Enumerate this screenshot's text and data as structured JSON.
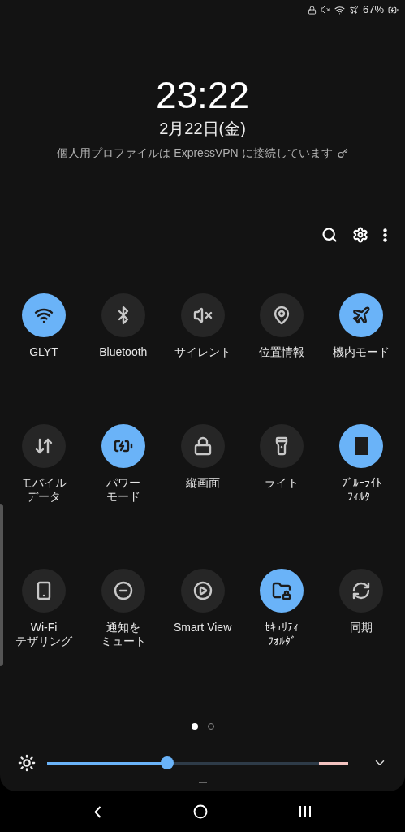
{
  "status_bar": {
    "battery": "67%"
  },
  "lock_info": {
    "time": "23:22",
    "date": "2月22日(金)",
    "vpn_notice": "個人用プロファイルは ExpressVPN に接続しています"
  },
  "tiles": [
    {
      "label": "GLYT",
      "on": true
    },
    {
      "label": "Bluetooth",
      "on": false
    },
    {
      "label": "サイレント",
      "on": false
    },
    {
      "label": "位置情報",
      "on": false
    },
    {
      "label": "機内モード",
      "on": true
    },
    {
      "lines": [
        "モバイル",
        "データ"
      ],
      "on": false
    },
    {
      "lines": [
        "パワー",
        "モード"
      ],
      "on": true
    },
    {
      "label": "縦画面",
      "on": false
    },
    {
      "label": "ライト",
      "on": false
    },
    {
      "lines": [
        "ﾌﾞﾙｰﾗｲﾄ",
        "ﾌｨﾙﾀｰ"
      ],
      "on": true
    },
    {
      "lines": [
        "Wi-Fi",
        "テザリング"
      ],
      "on": false
    },
    {
      "lines": [
        "通知を",
        "ミュート"
      ],
      "on": false
    },
    {
      "label": "Smart View",
      "on": false
    },
    {
      "lines": [
        "ｾｷｭﾘﾃｨ",
        "ﾌｫﾙﾀﾞ"
      ],
      "on": true
    },
    {
      "label": "同期",
      "on": false
    }
  ],
  "pages": [
    {
      "selected": true
    },
    {
      "selected": false
    }
  ],
  "brightness": {
    "level": 0.4
  }
}
